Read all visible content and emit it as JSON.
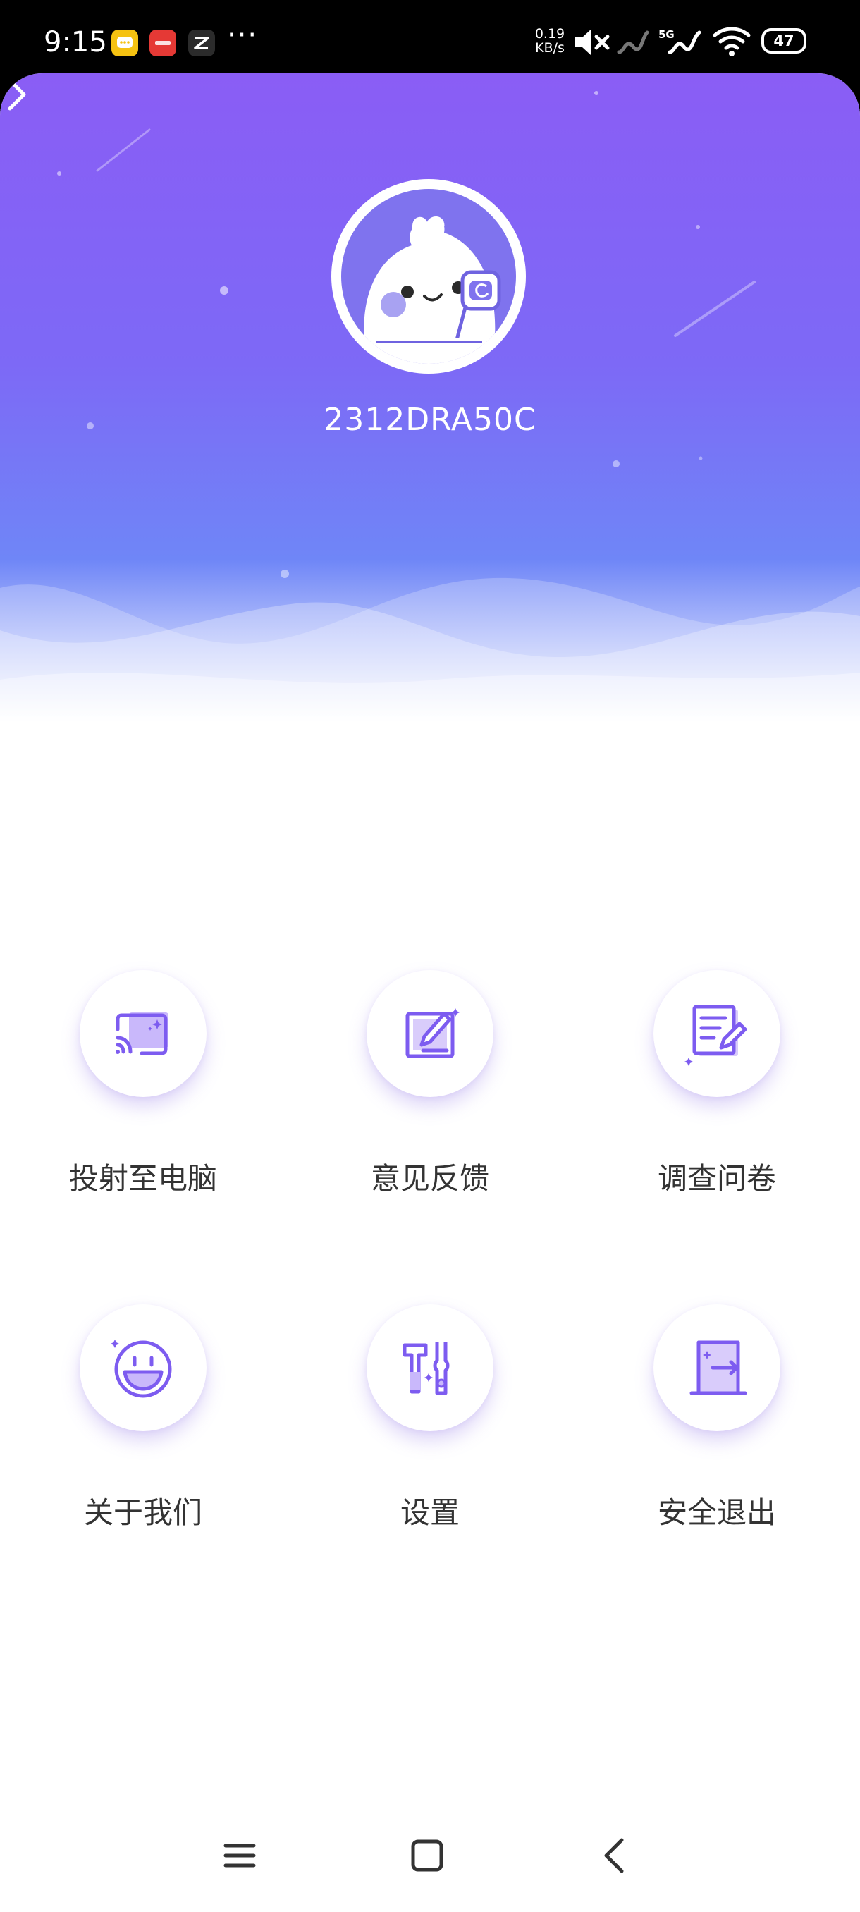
{
  "status_bar": {
    "time": "9:15",
    "more": "···",
    "net_speed_value": "0.19",
    "net_speed_unit": "KB/s",
    "network_type": "5G",
    "battery": "47",
    "battery_level": 0.47
  },
  "header": {
    "device_name": "2312DRA50C"
  },
  "menu": {
    "items": [
      {
        "label": "投射至电脑",
        "icon": "cast-icon"
      },
      {
        "label": "意见反馈",
        "icon": "feedback-edit-icon"
      },
      {
        "label": "调查问卷",
        "icon": "survey-icon"
      },
      {
        "label": "关于我们",
        "icon": "smile-icon"
      },
      {
        "label": "设置",
        "icon": "tools-icon"
      },
      {
        "label": "安全退出",
        "icon": "exit-icon"
      }
    ]
  },
  "colors": {
    "accent": "#7d5cf0",
    "header_top": "#8a5df5",
    "header_bottom": "#6f86f7",
    "label_text": "#333333"
  }
}
